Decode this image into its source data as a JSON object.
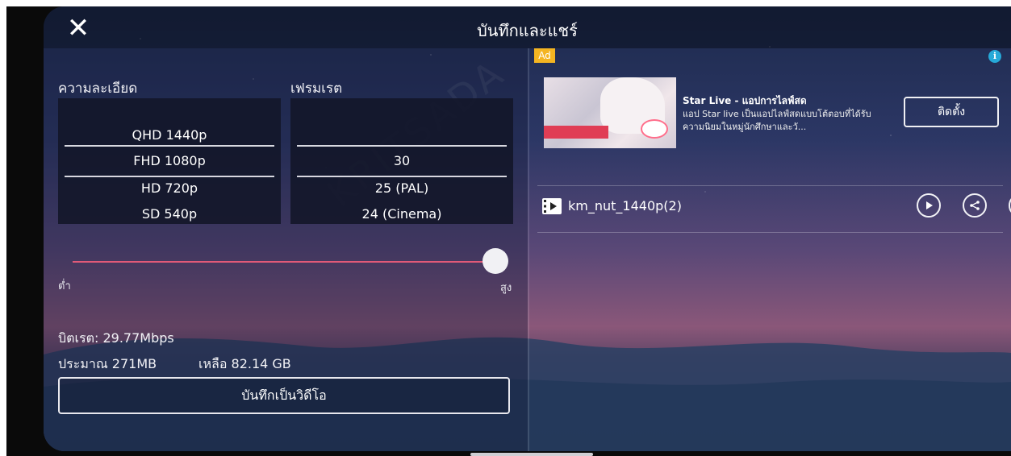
{
  "header": {
    "title": "บันทึกและแชร์",
    "close_icon": "close-icon"
  },
  "watermark": "KRITSADA",
  "resolution": {
    "label": "ความละเอียด",
    "options": [
      "QHD 1440p",
      "FHD 1080p",
      "HD 720p",
      "SD 540p"
    ],
    "selected": "FHD 1080p"
  },
  "framerate": {
    "label": "เฟรมเรต",
    "options": [
      "",
      "30",
      "25 (PAL)",
      "24 (Cinema)"
    ],
    "selected": "30"
  },
  "quality_slider": {
    "low_label": "ต่ำ",
    "high_label": "สูง",
    "value": 1.0,
    "track_color": "#e05a78"
  },
  "stats": {
    "bitrate": "บิตเรต: 29.77Mbps",
    "estimate": "ประมาณ 271MB",
    "remaining": "เหลือ 82.14 GB"
  },
  "save_button": "บันทึกเป็นวิดีโอ",
  "ad": {
    "badge": "Ad",
    "info_icon": "i",
    "title": "Star Live - แอปการไลฟ์สด",
    "description": "แอป Star live เป็นแอปไลฟ์สดแบบโต้ตอบที่ได้รับความนิยมในหมู่นักศึกษาและวั...",
    "install_button": "ติดตั้ง",
    "badge_color": "#f4b522"
  },
  "file": {
    "icon": "video-file-icon",
    "name": "km_nut_1440p(2)",
    "actions": [
      "play-icon",
      "share-icon",
      "delete-icon"
    ]
  }
}
